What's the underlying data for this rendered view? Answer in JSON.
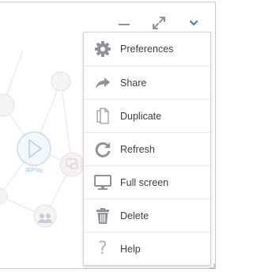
{
  "graph": {
    "node_label": "3DPlay"
  },
  "toolbar": {
    "minimize_icon": "minimize-icon",
    "expand_icon": "expand-icon",
    "menu_icon": "chevron-down-icon",
    "accent_color": "#3a7fc1"
  },
  "menu": {
    "items": [
      {
        "label": "Preferences",
        "icon": "gear-icon"
      },
      {
        "label": "Share",
        "icon": "share-arrow-icon"
      },
      {
        "label": "Duplicate",
        "icon": "duplicate-icon"
      },
      {
        "label": "Refresh",
        "icon": "refresh-icon"
      },
      {
        "label": "Full screen",
        "icon": "monitor-icon"
      },
      {
        "label": "Delete",
        "icon": "trash-icon"
      },
      {
        "label": "Help",
        "icon": "question-mark-icon"
      }
    ],
    "help_glyph": "?"
  }
}
